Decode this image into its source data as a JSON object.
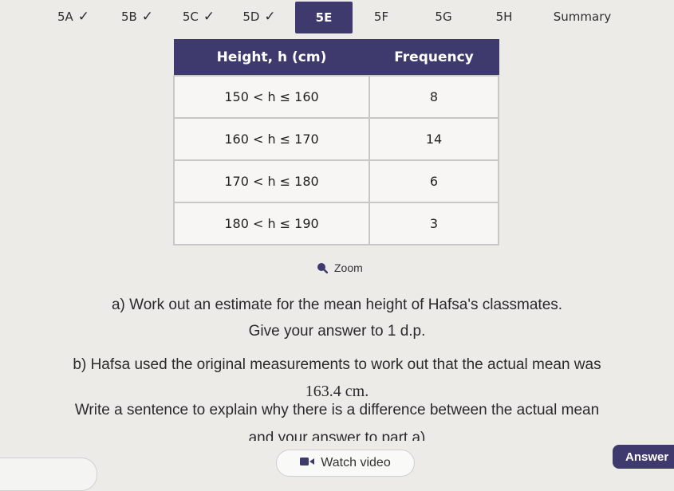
{
  "tabs": [
    {
      "label": "5A",
      "checked": true
    },
    {
      "label": "5B",
      "checked": true
    },
    {
      "label": "5C",
      "checked": true
    },
    {
      "label": "5D",
      "checked": true
    },
    {
      "label": "5E",
      "checked": false,
      "active": true
    },
    {
      "label": "5F",
      "checked": false
    },
    {
      "label": "5G",
      "checked": false
    },
    {
      "label": "5H",
      "checked": false
    },
    {
      "label": "Summary",
      "checked": false
    }
  ],
  "check_glyph": "✓",
  "table": {
    "headers": [
      "Height, h (cm)",
      "Frequency"
    ],
    "rows": [
      {
        "interval": "150 < h ≤ 160",
        "frequency": "8"
      },
      {
        "interval": "160 < h ≤ 170",
        "frequency": "14"
      },
      {
        "interval": "170 < h ≤ 180",
        "frequency": "6"
      },
      {
        "interval": "180 < h ≤ 190",
        "frequency": "3"
      }
    ]
  },
  "zoom_label": "Zoom",
  "question_a": {
    "line1": "a) Work out an estimate for the mean height of Hafsa's classmates.",
    "line2": "Give your answer to 1 d.p."
  },
  "question_b": {
    "line1": "b) Hafsa used the original measurements to work out that the actual mean was",
    "line2": "163.4 cm.",
    "line3": "Write a sentence to explain why there is a difference between the actual mean",
    "line4": "and your answer to part a)"
  },
  "watch_video_label": "Watch video",
  "answer_label": "Answer",
  "colors": {
    "accent": "#3f3a6d",
    "background": "#ecebe8"
  }
}
